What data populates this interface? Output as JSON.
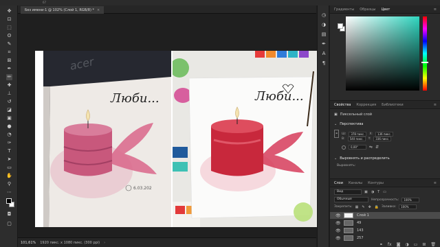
{
  "document": {
    "tab_title": "Без имени-1 @ 102% (Слой 1, RGB/8) *",
    "close": "×"
  },
  "top_ruler": {
    "number": "67"
  },
  "status": {
    "zoom": "101,61%",
    "info": "1920 пикс. x 1080 пикс. (300 ppi)",
    "arrow": "›"
  },
  "panels": {
    "color_tabs": [
      {
        "label": "Градиенты",
        "active": false
      },
      {
        "label": "Образцы",
        "active": false
      },
      {
        "label": "Цвет",
        "active": true
      }
    ],
    "props_tabs": [
      {
        "label": "Свойства",
        "active": true
      },
      {
        "label": "Коррекция",
        "active": false
      },
      {
        "label": "Библиотеки",
        "active": false
      }
    ],
    "layers_tabs": [
      {
        "label": "Слои",
        "active": true
      },
      {
        "label": "Каналы",
        "active": false
      },
      {
        "label": "Контуры",
        "active": false
      }
    ],
    "menu_glyph": "≡"
  },
  "properties": {
    "pixel_layer_label": "Пиксельный слой",
    "transform_title": "Перспектива",
    "w_label": "Ш:",
    "w_value": "378 пикс.",
    "x_label": "X:",
    "x_value": "136 пикс.",
    "h_label": "В:",
    "h_value": "540 пикс.",
    "y_label": "Y:",
    "y_value": "336 пикс.",
    "angle_value": "0,00°",
    "align_title": "Выровнять и распределить",
    "align_label": "Выровнять:",
    "caret_open": "⌄",
    "caret_closed": "›"
  },
  "layers": {
    "filter_label": "Вид",
    "blend_mode": "Обычные",
    "opacity_label": "Непрозрачность:",
    "opacity_value": "100%",
    "lock_label": "Закрепить:",
    "fill_label": "Заливка:",
    "fill_value": "100%",
    "items": [
      {
        "name": "Слой 1",
        "selected": true,
        "thumb": "white"
      },
      {
        "name": "49",
        "selected": false,
        "thumb": "gray"
      },
      {
        "name": "143",
        "selected": false,
        "thumb": "gray"
      },
      {
        "name": "257",
        "selected": false,
        "thumb": "gray"
      }
    ],
    "eye": "👁"
  },
  "canvas_photos": {
    "left": {
      "handwriting": "Люби...",
      "date_text": "6.03.202",
      "brand_text": "acer"
    },
    "right": {
      "handwriting": "Люби..."
    }
  },
  "toolbar_icons": [
    "move-tool-icon",
    "artboard-icon",
    "marquee-tool-icon",
    "lasso-tool-icon",
    "quick-select-icon",
    "crop-tool-icon",
    "frame-tool-icon",
    "eyedropper-icon",
    "spot-healing-icon",
    "brush-tool-icon",
    "clone-stamp-icon",
    "history-brush-icon",
    "eraser-tool-icon",
    "gradient-tool-icon",
    "blur-tool-icon",
    "dodge-tool-icon",
    "pen-tool-icon",
    "type-tool-icon",
    "path-select-icon",
    "shape-tool-icon",
    "hand-tool-icon",
    "zoom-tool-icon",
    "more-tools-icon"
  ],
  "colors": {
    "accent": "#2fd6c0",
    "ui_dark": "#2b2b2b",
    "candle_red": "#c8283c",
    "candle_pink": "#c8587c"
  }
}
